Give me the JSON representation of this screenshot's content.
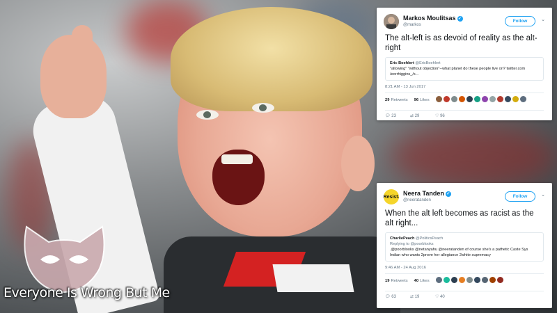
{
  "tweets": [
    {
      "author": "Markos Moulitsas",
      "handle": "@markos",
      "follow_label": "Follow",
      "text": "The alt-left is as devoid of reality as the alt-right",
      "quote": {
        "author": "Eric Boehlert",
        "handle": "@EricBoehlert",
        "text": "\"allowing\" \"without objection\"--what planet do these people live on? twitter.com /eorrhiggins_/s..."
      },
      "timestamp": "8:21 AM - 13 Jun 2017",
      "retweets": "29",
      "retweets_label": "Retweets",
      "likes": "96",
      "likes_label": "Likes",
      "action_counts": {
        "reply": "23",
        "retweet": "29",
        "like": "96"
      },
      "liker_colors": [
        "#8b5e3c",
        "#c0392b",
        "#7f8c8d",
        "#d35400",
        "#2c3e50",
        "#16a085",
        "#8e44ad",
        "#95a5a6",
        "#b03a2e",
        "#34495e",
        "#d4ac0d",
        "#5d6d7e"
      ]
    },
    {
      "author": "Neera Tanden",
      "handle": "@neeratanden",
      "avatar_text": "Resist.",
      "follow_label": "Follow",
      "text": "When the alt left becomes as racist as the alt right...",
      "quote": {
        "author": "CharliePeach",
        "handle": "@PoliticsPeach",
        "reply_to": "Replying to @poorblooks",
        "text": ".@poorblooks @netanyahu @neeratanden of course she's a pathetic Caste Sys Indian who wants 2prove her allegiance 2white supremacy"
      },
      "timestamp": "9:46 AM - 24 Aug 2016",
      "retweets": "19",
      "retweets_label": "Retweets",
      "likes": "40",
      "likes_label": "Likes",
      "action_counts": {
        "reply": "63",
        "retweet": "19",
        "like": "40"
      },
      "liker_colors": [
        "#5d6d7e",
        "#1abc9c",
        "#2c3e50",
        "#e67e22",
        "#7f8c8d",
        "#34495e",
        "#566573",
        "#a04000",
        "#922b21"
      ]
    }
  ],
  "watermark": {
    "text": "Everyone Is Wrong But Me",
    "logo": "cat-mask-logo"
  },
  "icons": {
    "reply": "reply-icon",
    "retweet": "retweet-icon",
    "like": "heart-icon",
    "verified": "verified-badge-icon",
    "caret": "chevron-down-icon"
  },
  "colors": {
    "twitter_blue": "#1da1f2",
    "resist_yellow": "#f5d52a",
    "shirt_red": "#d42222"
  }
}
